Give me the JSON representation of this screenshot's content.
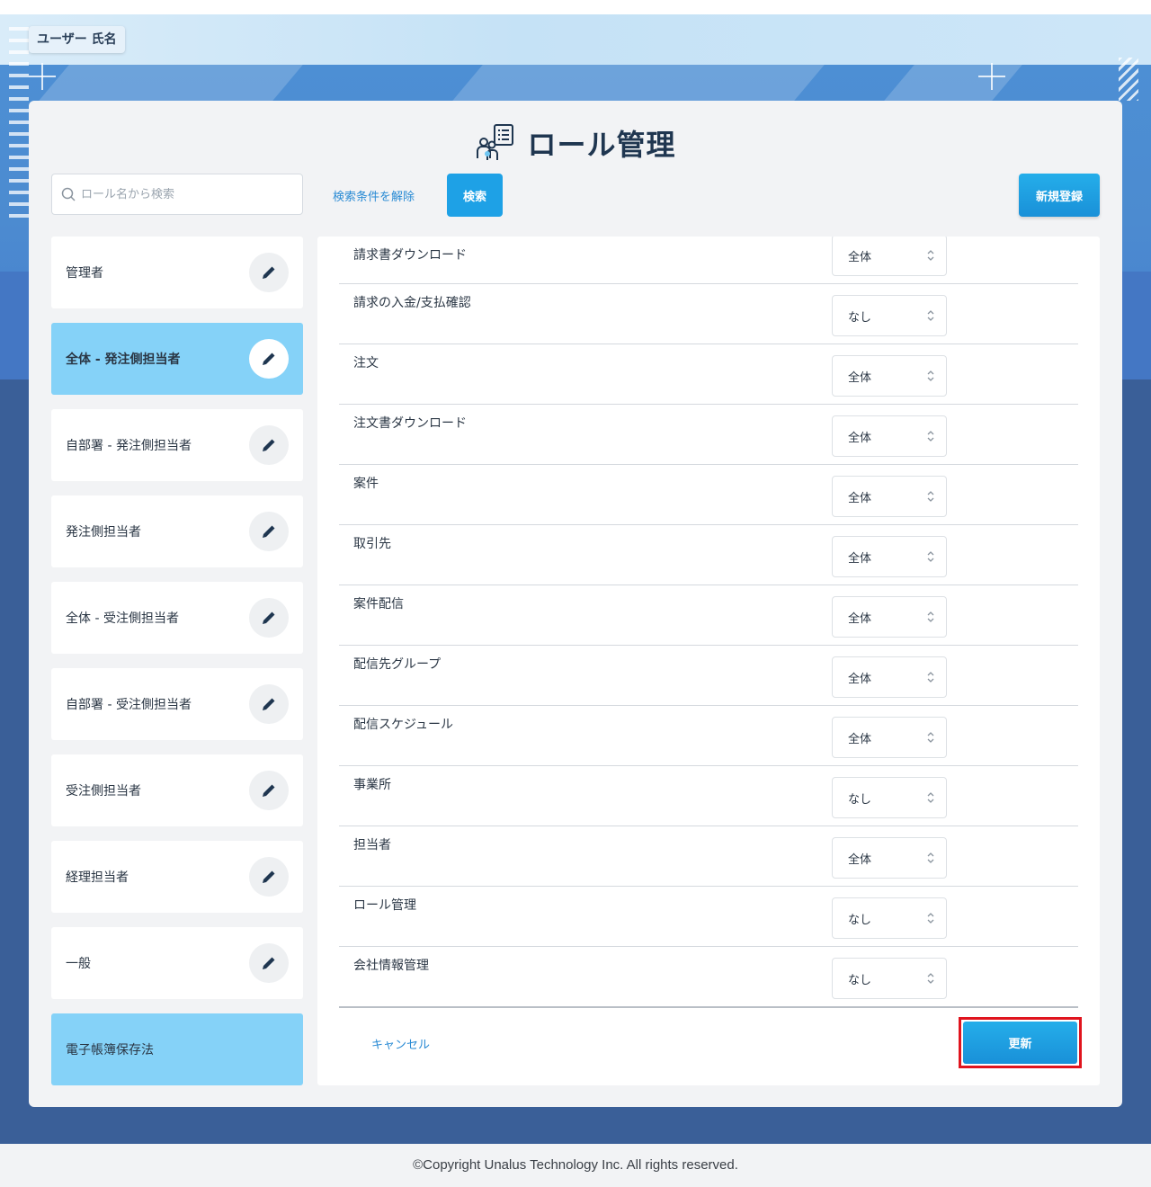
{
  "header": {
    "user_name": "ユーザー 氏名"
  },
  "page": {
    "title": "ロール管理"
  },
  "toolbar": {
    "search_placeholder": "ロール名から検索",
    "clear_label": "検索条件を解除",
    "search_label": "検索",
    "new_label": "新規登録"
  },
  "roles": [
    {
      "label": "管理者",
      "state": "default"
    },
    {
      "label": "全体 - 発注側担当者",
      "state": "selected"
    },
    {
      "label": "自部署 - 発注側担当者",
      "state": "default"
    },
    {
      "label": "発注側担当者",
      "state": "default"
    },
    {
      "label": "全体 - 受注側担当者",
      "state": "default"
    },
    {
      "label": "自部署 - 受注側担当者",
      "state": "default"
    },
    {
      "label": "受注側担当者",
      "state": "default"
    },
    {
      "label": "経理担当者",
      "state": "default"
    },
    {
      "label": "一般",
      "state": "default"
    },
    {
      "label": "電子帳簿保存法",
      "state": "highlighted"
    }
  ],
  "permissions": [
    {
      "label": "請求書ダウンロード",
      "value": "全体"
    },
    {
      "label": "請求の入金/支払確認",
      "value": "なし"
    },
    {
      "label": "注文",
      "value": "全体"
    },
    {
      "label": "注文書ダウンロード",
      "value": "全体"
    },
    {
      "label": "案件",
      "value": "全体"
    },
    {
      "label": "取引先",
      "value": "全体"
    },
    {
      "label": "案件配信",
      "value": "全体"
    },
    {
      "label": "配信先グループ",
      "value": "全体"
    },
    {
      "label": "配信スケジュール",
      "value": "全体"
    },
    {
      "label": "事業所",
      "value": "なし"
    },
    {
      "label": "担当者",
      "value": "全体"
    },
    {
      "label": "ロール管理",
      "value": "なし"
    },
    {
      "label": "会社情報管理",
      "value": "なし"
    }
  ],
  "actions": {
    "cancel_label": "キャンセル",
    "update_label": "更新"
  },
  "footer": {
    "copyright": "©Copyright Unalus Technology Inc. All rights reserved."
  },
  "colors": {
    "accent": "#1ea1e6",
    "selected_role": "#85d2f8",
    "highlight_frame": "#e0141e",
    "title": "#1f3650"
  },
  "icons": {
    "title": "role-management-icon",
    "search": "search-icon",
    "edit": "pencil-icon",
    "select": "chevron-updown-icon"
  }
}
